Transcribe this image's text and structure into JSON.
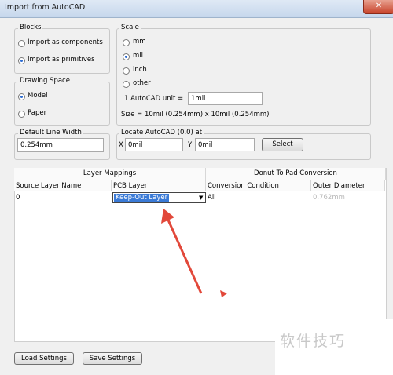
{
  "window": {
    "title": "Import from AutoCAD",
    "close_glyph": "✕"
  },
  "blocks": {
    "title": "Blocks",
    "options": [
      {
        "label": "Import as components",
        "selected": false
      },
      {
        "label": "Import as primitives",
        "selected": true
      }
    ]
  },
  "drawing_space": {
    "title": "Drawing Space",
    "options": [
      {
        "label": "Model",
        "selected": true
      },
      {
        "label": "Paper",
        "selected": false
      }
    ]
  },
  "scale": {
    "title": "Scale",
    "options": [
      {
        "label": "mm",
        "selected": false
      },
      {
        "label": "mil",
        "selected": true
      },
      {
        "label": "inch",
        "selected": false
      },
      {
        "label": "other",
        "selected": false
      }
    ],
    "unit_label": "1 AutoCAD unit =",
    "unit_value": "1mil",
    "size_text": "Size = 10mil (0.254mm) x 10mil (0.254mm)"
  },
  "default_line_width": {
    "title": "Default Line Width",
    "value": "0.254mm"
  },
  "locate": {
    "title": "Locate AutoCAD (0,0) at",
    "x_label": "X",
    "x_value": "0mil",
    "y_label": "Y",
    "y_value": "0mil",
    "select_label": "Select"
  },
  "table": {
    "group_headers": {
      "layer_mappings": "Layer Mappings",
      "donut": "Donut To Pad Conversion"
    },
    "columns": [
      "Source Layer Name",
      "PCB Layer",
      "Conversion Condition",
      "Outer Diameter"
    ],
    "rows": [
      {
        "source": "0",
        "pcb_layer": "Keep-Out Layer",
        "condition": "All",
        "outer_diameter": "0.762mm"
      }
    ]
  },
  "buttons": {
    "load": "Load Settings",
    "save": "Save Settings"
  },
  "watermark": "软件技巧",
  "colors": {
    "arrow": "#e2483a",
    "selection": "#3a7ad6"
  }
}
